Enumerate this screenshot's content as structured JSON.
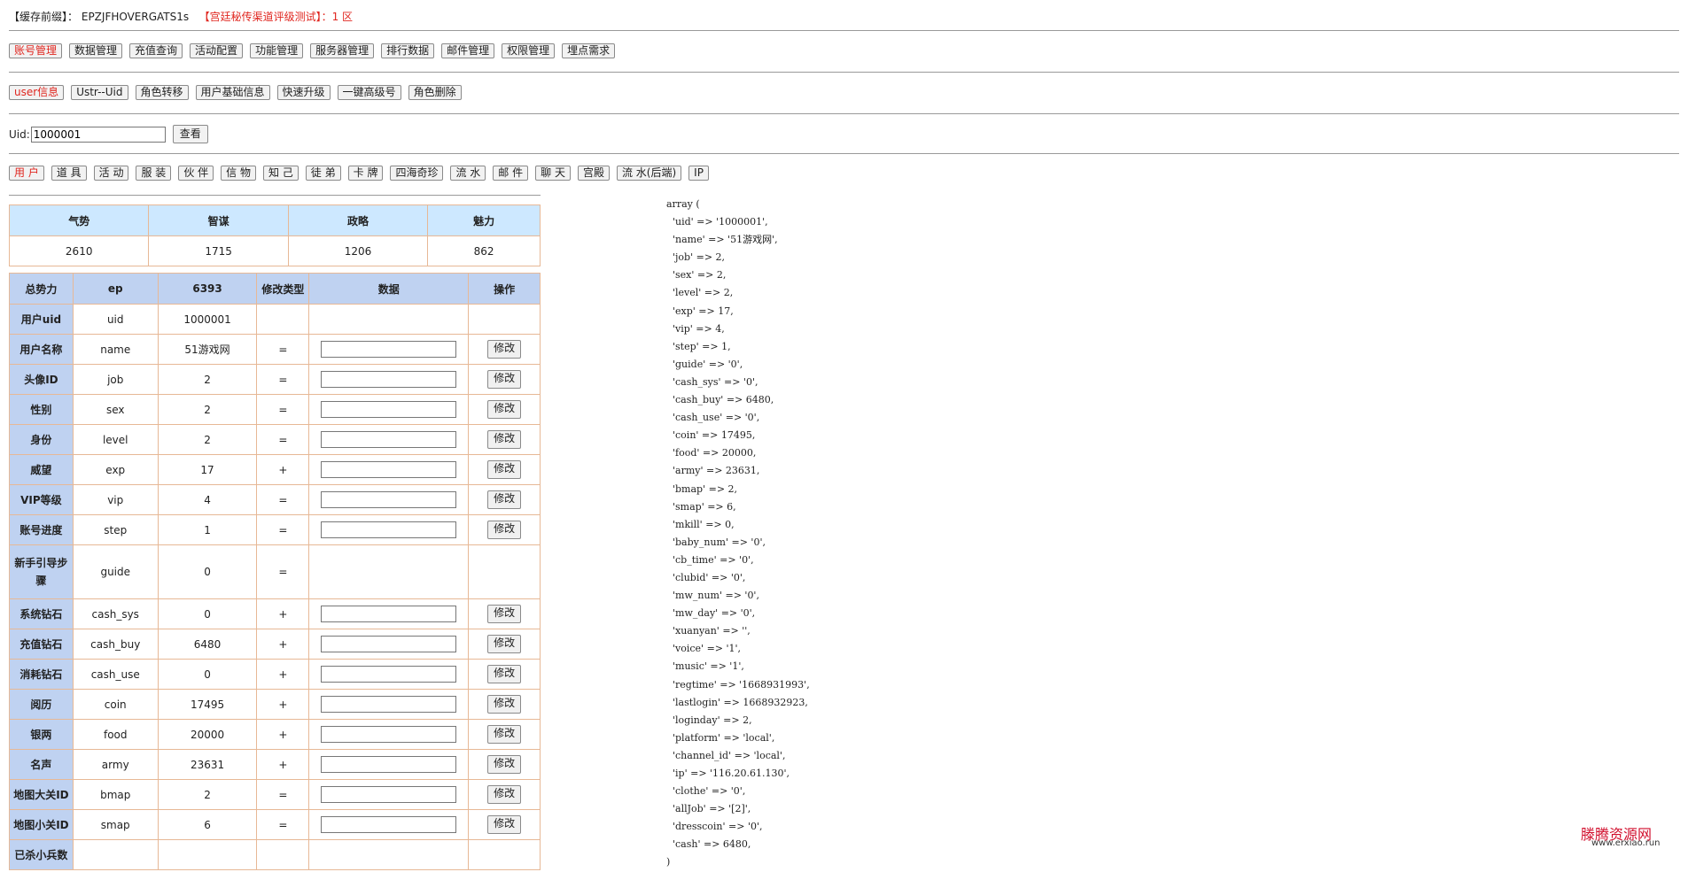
{
  "header": {
    "cache_label": "【缓存前缀】",
    "cache_sep": "：",
    "cache_value": "EPZJFHOVERGATS1s",
    "server_name": "【宫廷秘传渠道评级测试】",
    "server_zone": "：1 区"
  },
  "nav_main": [
    "账号管理",
    "数据管理",
    "充值查询",
    "活动配置",
    "功能管理",
    "服务器管理",
    "排行数据",
    "邮件管理",
    "权限管理",
    "埋点需求"
  ],
  "nav_sub": [
    "user信息",
    "Ustr--Uid",
    "角色转移",
    "用户基础信息",
    "快速升级",
    "一键高级号",
    "角色删除"
  ],
  "query": {
    "label": "Uid:",
    "value": "1000001",
    "button": "查看"
  },
  "tabs": [
    "用 户",
    "道 具",
    "活 动",
    "服 装",
    "伙 伴",
    "信 物",
    "知 己",
    "徒 弟",
    "卡 牌",
    "四海奇珍",
    "流 水",
    "邮 件",
    "聊 天",
    "宫殿",
    "流 水(后端)",
    "IP"
  ],
  "stats": {
    "headers": [
      "气势",
      "智谋",
      "政略",
      "魅力"
    ],
    "values": [
      "2610",
      "1715",
      "1206",
      "862"
    ]
  },
  "table": {
    "headers": [
      "总势力",
      "ep",
      "6393",
      "修改类型",
      "数据",
      "操作"
    ],
    "modify_label": "修改",
    "rows": [
      {
        "label": "用户uid",
        "key": "uid",
        "value": "1000001",
        "op": "",
        "editable": false
      },
      {
        "label": "用户名称",
        "key": "name",
        "value": "51游戏网",
        "op": "=",
        "editable": true
      },
      {
        "label": "头像ID",
        "key": "job",
        "value": "2",
        "op": "=",
        "editable": true
      },
      {
        "label": "性别",
        "key": "sex",
        "value": "2",
        "op": "=",
        "editable": true
      },
      {
        "label": "身份",
        "key": "level",
        "value": "2",
        "op": "=",
        "editable": true
      },
      {
        "label": "威望",
        "key": "exp",
        "value": "17",
        "op": "+",
        "editable": true
      },
      {
        "label": "VIP等级",
        "key": "vip",
        "value": "4",
        "op": "=",
        "editable": true
      },
      {
        "label": "账号进度",
        "key": "step",
        "value": "1",
        "op": "=",
        "editable": true
      },
      {
        "label": "新手引导步骤",
        "key": "guide",
        "value": "0",
        "op": "=",
        "editable": false
      },
      {
        "label": "系统钻石",
        "key": "cash_sys",
        "value": "0",
        "op": "+",
        "editable": true
      },
      {
        "label": "充值钻石",
        "key": "cash_buy",
        "value": "6480",
        "op": "+",
        "editable": true
      },
      {
        "label": "消耗钻石",
        "key": "cash_use",
        "value": "0",
        "op": "+",
        "editable": true
      },
      {
        "label": "阅历",
        "key": "coin",
        "value": "17495",
        "op": "+",
        "editable": true
      },
      {
        "label": "银两",
        "key": "food",
        "value": "20000",
        "op": "+",
        "editable": true
      },
      {
        "label": "名声",
        "key": "army",
        "value": "23631",
        "op": "+",
        "editable": true
      },
      {
        "label": "地图大关ID",
        "key": "bmap",
        "value": "2",
        "op": "=",
        "editable": true
      },
      {
        "label": "地图小关ID",
        "key": "smap",
        "value": "6",
        "op": "=",
        "editable": true
      },
      {
        "label": "已杀小兵数",
        "key": "",
        "value": "",
        "op": "",
        "editable": true
      }
    ]
  },
  "dump": [
    "array (",
    "  'uid' => '1000001',",
    "  'name' => '51游戏网',",
    "  'job' => 2,",
    "  'sex' => 2,",
    "  'level' => 2,",
    "  'exp' => 17,",
    "  'vip' => 4,",
    "  'step' => 1,",
    "  'guide' => '0',",
    "  'cash_sys' => '0',",
    "  'cash_buy' => 6480,",
    "  'cash_use' => '0',",
    "  'coin' => 17495,",
    "  'food' => 20000,",
    "  'army' => 23631,",
    "  'bmap' => 2,",
    "  'smap' => 6,",
    "  'mkill' => 0,",
    "  'baby_num' => '0',",
    "  'cb_time' => '0',",
    "  'clubid' => '0',",
    "  'mw_num' => '0',",
    "  'mw_day' => '0',",
    "  'xuanyan' => '',",
    "  'voice' => '1',",
    "  'music' => '1',",
    "  'regtime' => '1668931993',",
    "  'lastlogin' => 1668932923,",
    "  'loginday' => 2,",
    "  'platform' => 'local',",
    "  'channel_id' => 'local',",
    "  'ip' => '116.20.61.130',",
    "  'clothe' => '0',",
    "  'allJob' => '[2]',",
    "  'dresscoin' => '0',",
    "  'cash' => 6480,",
    ")"
  ],
  "watermark": {
    "title": "滕腾资源网",
    "url": "www.erxiao.run"
  }
}
